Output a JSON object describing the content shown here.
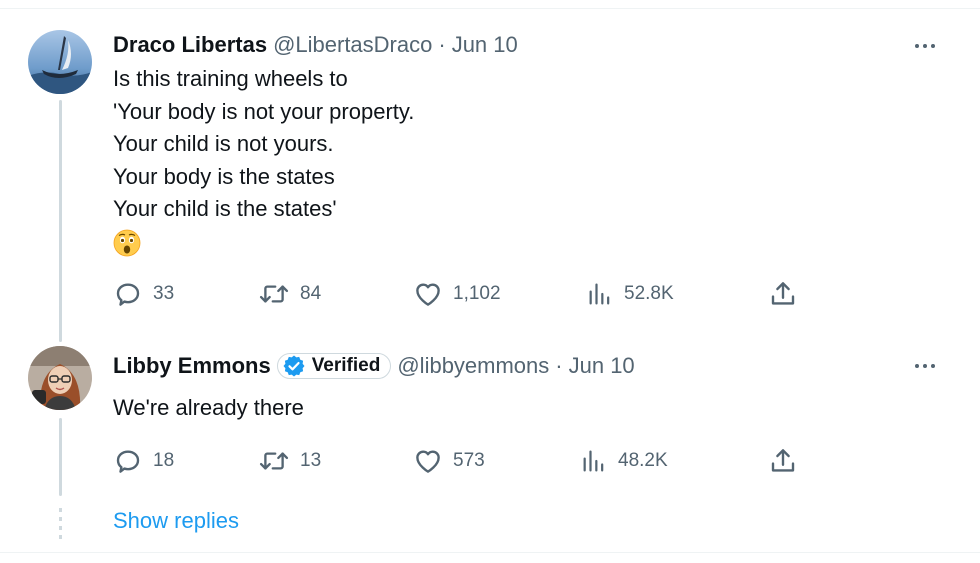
{
  "tweets": [
    {
      "author_name": "Draco Libertas",
      "handle": "@LibertasDraco",
      "separator": "·",
      "date": "Jun 10",
      "text_lines": [
        "Is this training wheels to",
        "'Your body is not your property.",
        "Your child is not yours.",
        "Your body is the states",
        "Your child is the states'"
      ],
      "emoji": "astonished-face",
      "stats": {
        "replies": "33",
        "retweets": "84",
        "likes": "1,102",
        "views": "52.8K"
      }
    },
    {
      "author_name": "Libby Emmons",
      "verified_label": "Verified",
      "handle": "@libbyemmons",
      "separator": "·",
      "date": "Jun 10",
      "text_lines": [
        "We're already there"
      ],
      "stats": {
        "replies": "18",
        "retweets": "13",
        "likes": "573",
        "views": "48.2K"
      }
    }
  ],
  "show_replies": "Show replies",
  "colors": {
    "accent": "#1d9bf0",
    "muted": "#536471",
    "text": "#0f1419",
    "thread_line": "#cfd9de"
  }
}
